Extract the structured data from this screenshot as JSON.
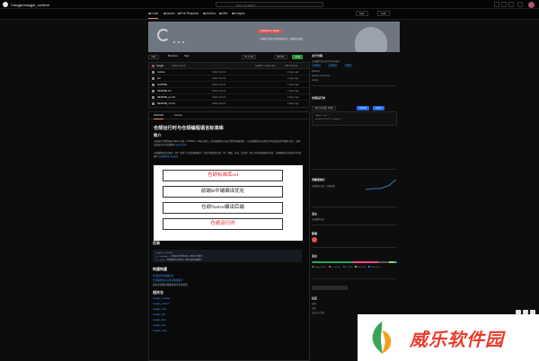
{
  "topbar": {
    "repo_path": "Cangjie/cangjie_runtime",
    "search_placeholder": "Type / to search"
  },
  "nav": {
    "items": [
      {
        "label": "Code"
      },
      {
        "label": "Issues"
      },
      {
        "label": "Pull Requests"
      },
      {
        "label": "Actions"
      },
      {
        "label": "Wiki"
      },
      {
        "label": "Insights"
      }
    ],
    "star": "Star",
    "fork": "Fork"
  },
  "banner": {
    "button": "Subscribe to unlock",
    "text": "仓颉运行时社区代码托管仓库 · 欢迎提交贡献"
  },
  "filebar": {
    "branch": "main",
    "branches": "Branches",
    "tags": "Tags",
    "goto": "Go to file",
    "add": "Add file",
    "code": "Code"
  },
  "commit": {
    "author": "cangjie",
    "message": "Initial commit",
    "hash": "3a1f0c2 · 2 days ago",
    "count": "128 Commits"
  },
  "files": [
    {
      "name": "runtime",
      "msg": "Initial commit",
      "time": "2 days ago"
    },
    {
      "name": "std",
      "msg": "Initial commit",
      "time": "2 days ago"
    },
    {
      "name": "LICENSE",
      "msg": "Initial commit",
      "time": "2 days ago"
    },
    {
      "name": "README.md",
      "msg": "Initial commit",
      "time": "2 days ago"
    },
    {
      "name": "README_en.md",
      "msg": "Initial commit",
      "time": "2 days ago"
    },
    {
      "name": "README_zh.md",
      "msg": "Initial commit",
      "time": "2 days ago"
    }
  ],
  "readme": {
    "tab_readme": "README",
    "tab_license": "License",
    "title": "仓颉运行时与仓颉编程语言标准库",
    "intro_heading": "简介",
    "intro_text": "仓颉运行时提供面向 Native 后端（CJNative）的核心能力，是仓颉编程语言运行所需的基础组件，与仓颉编程语言标准库共同支撑应用的构建与执行。更多仓颉运行时介绍请参考",
    "intro_link": "运行时文档",
    "intro_text2": "仓颉编程语言标准库（std）提供了丰富的基础能力，包括内置类型扩展、I/O、网络、并发、反射等，便于开发者快速编写应用。仓颉编程语言标准库介绍请参考",
    "intro_link2": "仓颉编程语言标准库",
    "diagram": {
      "box1": "仓颉标准库std",
      "box2": "前端&中端编译优化",
      "box3": "仓颉Native编译后端",
      "box4": "仓颉运行时"
    },
    "toc_heading": "目录",
    "code_lines": [
      "cangjie_runtime/",
      "├── runtime        # 仓颉运行时代码目录，提供运行时能力",
      "└── std            # 仓颉编程语言标准库，提供丰富的基础能力"
    ],
    "build_heading": "构建构建",
    "build_links": [
      "仓颉运行时构建指导",
      "仓颉编程语言标准库构建指导",
      "更多仓颉相关构建请参考仓颉社区"
    ],
    "related_heading": "相关仓",
    "related_links": [
      "cangjie_compiler",
      "cangjie_runtime",
      "cangjie_tools",
      "cangjie_stdx",
      "cangjie_docs",
      "cangjie_test",
      "cangjie_multi"
    ]
  },
  "sidebar": {
    "about_heading": "关于仓颉",
    "about_text": "仓颉编程语言运行时与标准库",
    "tags": [
      "cangjie",
      "runtime",
      "stdlib"
    ],
    "readme": "Readme",
    "license": "Apache-2.0 license",
    "activity": "Activity",
    "releases_heading": "仓颉运行时",
    "clone_method": "Use Cangjie Hook",
    "clone_btn1": "GitHub",
    "clone_btn2": "Clone",
    "code_lines": [
      "import std.*",
      "  println(\"Hello Cangjie\")"
    ],
    "contrib_heading": "贡献者统计",
    "contrib_text": "近期提交活动 · 持续更新",
    "contrib_count": "12",
    "env_heading": "语言",
    "env_text": "仓颉编程语言",
    "deploy_heading": "部署",
    "langs_heading": "语言",
    "langs": [
      {
        "name": "Cangjie",
        "pct": "48.2%",
        "color": "#2da44e"
      },
      {
        "name": "C++",
        "pct": "30.1%",
        "color": "#f34b7d"
      },
      {
        "name": "C",
        "pct": "12.4%",
        "color": "#555555"
      },
      {
        "name": "Shell",
        "pct": "5.8%",
        "color": "#89e051"
      },
      {
        "name": "Other",
        "pct": "3.5%",
        "color": "#4493f8"
      }
    ],
    "lang_shares": [
      48.2,
      30.1,
      12.4,
      5.8,
      3.5
    ],
    "footer_heading": "社区",
    "footer_items": [
      "官网",
      "文档",
      "论坛与讨论区"
    ]
  },
  "watermark": {
    "text": "威乐软件园"
  }
}
